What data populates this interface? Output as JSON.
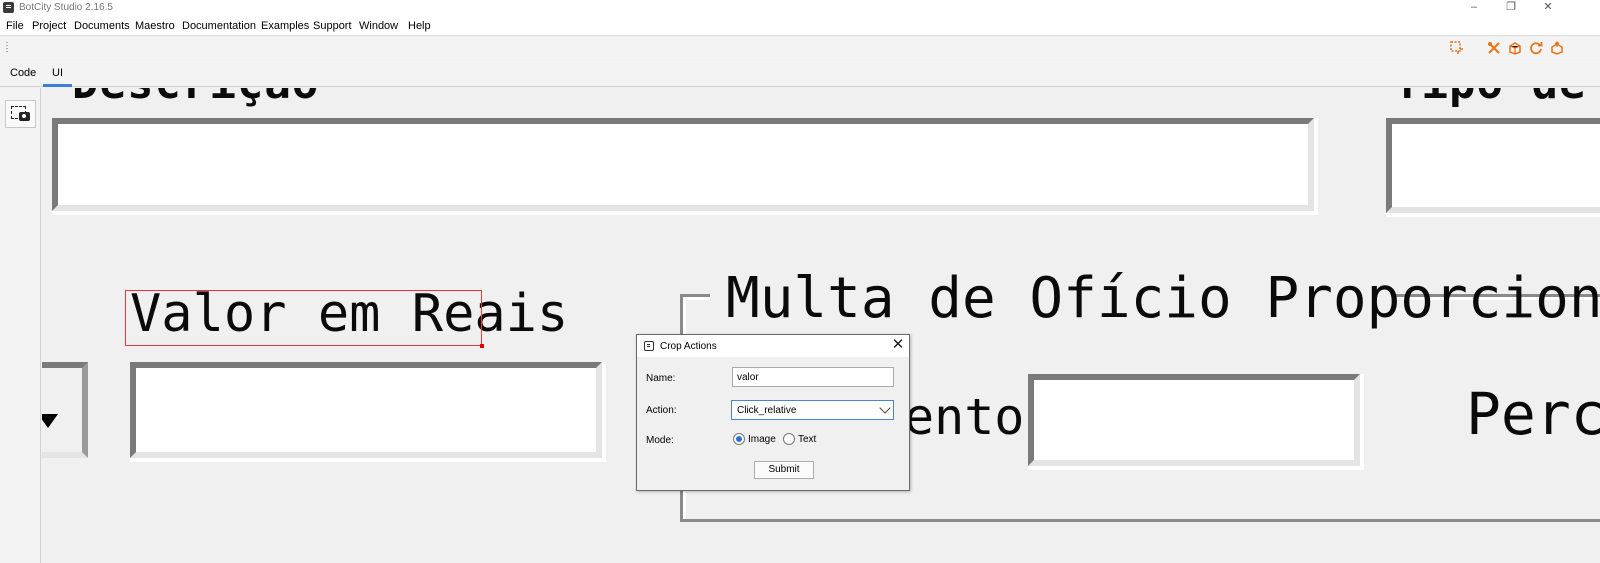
{
  "window": {
    "title": "BotCity Studio 2.16.5",
    "minimize": "–",
    "maximize": "❐",
    "close": "✕"
  },
  "menu": [
    "File",
    "Project",
    "Documents",
    "Maestro",
    "Documentation",
    "Examples",
    "Support",
    "Window",
    "Help"
  ],
  "tabs": {
    "code": "Code",
    "ui": "UI",
    "active": "UI"
  },
  "toolbar_icons": [
    "crop-icon",
    "tools-icon",
    "package-icon",
    "refresh-icon",
    "deploy-icon"
  ],
  "canvas": {
    "top_left_label_fragment": "Descrição",
    "top_right_label_fragment": "Tipo de",
    "value_label": "Valor em Reais",
    "group_title": "Multa de Ofício Proporcional",
    "pagamento_fragment": "ento:",
    "perc_fragment": "Perc"
  },
  "dialog": {
    "title": "Crop Actions",
    "name_label": "Name:",
    "name_value": "valor",
    "action_label": "Action:",
    "action_value": "Click_relative",
    "mode_label": "Mode:",
    "mode_options": [
      "Image",
      "Text"
    ],
    "mode_selected": "Image",
    "submit_label": "Submit",
    "close_glyph": "✕"
  },
  "colors": {
    "accent": "#3b7dd8",
    "toolbar_icon": "#e8731a",
    "selection": "#e33333"
  }
}
